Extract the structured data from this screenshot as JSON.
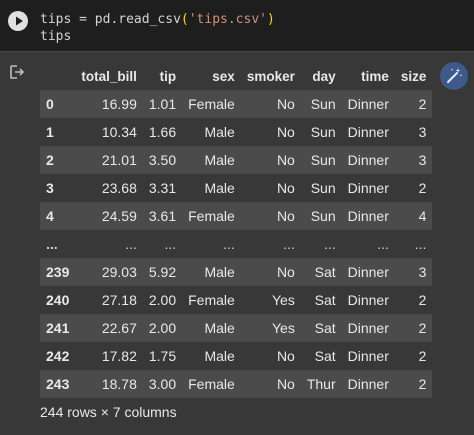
{
  "code": {
    "line1_var": "tips",
    "line1_op": " = ",
    "line1_call": "pd.read_csv",
    "line1_open": "(",
    "line1_str": "'tips.csv'",
    "line1_close": ")",
    "line2": "tips"
  },
  "icons": {
    "run": "play-icon",
    "output": "output-redirect-icon",
    "magic": "magic-wand-icon"
  },
  "colors": {
    "background": "#383838",
    "code_background": "#1e1e1e",
    "row_stripe": "#4b4b4b",
    "magic_button": "#3e5a88"
  },
  "table": {
    "columns": [
      "total_bill",
      "tip",
      "sex",
      "smoker",
      "day",
      "time",
      "size"
    ],
    "rows": [
      {
        "index": "0",
        "cells": [
          "16.99",
          "1.01",
          "Female",
          "No",
          "Sun",
          "Dinner",
          "2"
        ]
      },
      {
        "index": "1",
        "cells": [
          "10.34",
          "1.66",
          "Male",
          "No",
          "Sun",
          "Dinner",
          "3"
        ]
      },
      {
        "index": "2",
        "cells": [
          "21.01",
          "3.50",
          "Male",
          "No",
          "Sun",
          "Dinner",
          "3"
        ]
      },
      {
        "index": "3",
        "cells": [
          "23.68",
          "3.31",
          "Male",
          "No",
          "Sun",
          "Dinner",
          "2"
        ]
      },
      {
        "index": "4",
        "cells": [
          "24.59",
          "3.61",
          "Female",
          "No",
          "Sun",
          "Dinner",
          "4"
        ]
      },
      {
        "index": "...",
        "cells": [
          "...",
          "...",
          "...",
          "...",
          "...",
          "...",
          "..."
        ]
      },
      {
        "index": "239",
        "cells": [
          "29.03",
          "5.92",
          "Male",
          "No",
          "Sat",
          "Dinner",
          "3"
        ]
      },
      {
        "index": "240",
        "cells": [
          "27.18",
          "2.00",
          "Female",
          "Yes",
          "Sat",
          "Dinner",
          "2"
        ]
      },
      {
        "index": "241",
        "cells": [
          "22.67",
          "2.00",
          "Male",
          "Yes",
          "Sat",
          "Dinner",
          "2"
        ]
      },
      {
        "index": "242",
        "cells": [
          "17.82",
          "1.75",
          "Male",
          "No",
          "Sat",
          "Dinner",
          "2"
        ]
      },
      {
        "index": "243",
        "cells": [
          "18.78",
          "3.00",
          "Female",
          "No",
          "Thur",
          "Dinner",
          "2"
        ]
      }
    ]
  },
  "caption": "244 rows × 7 columns"
}
